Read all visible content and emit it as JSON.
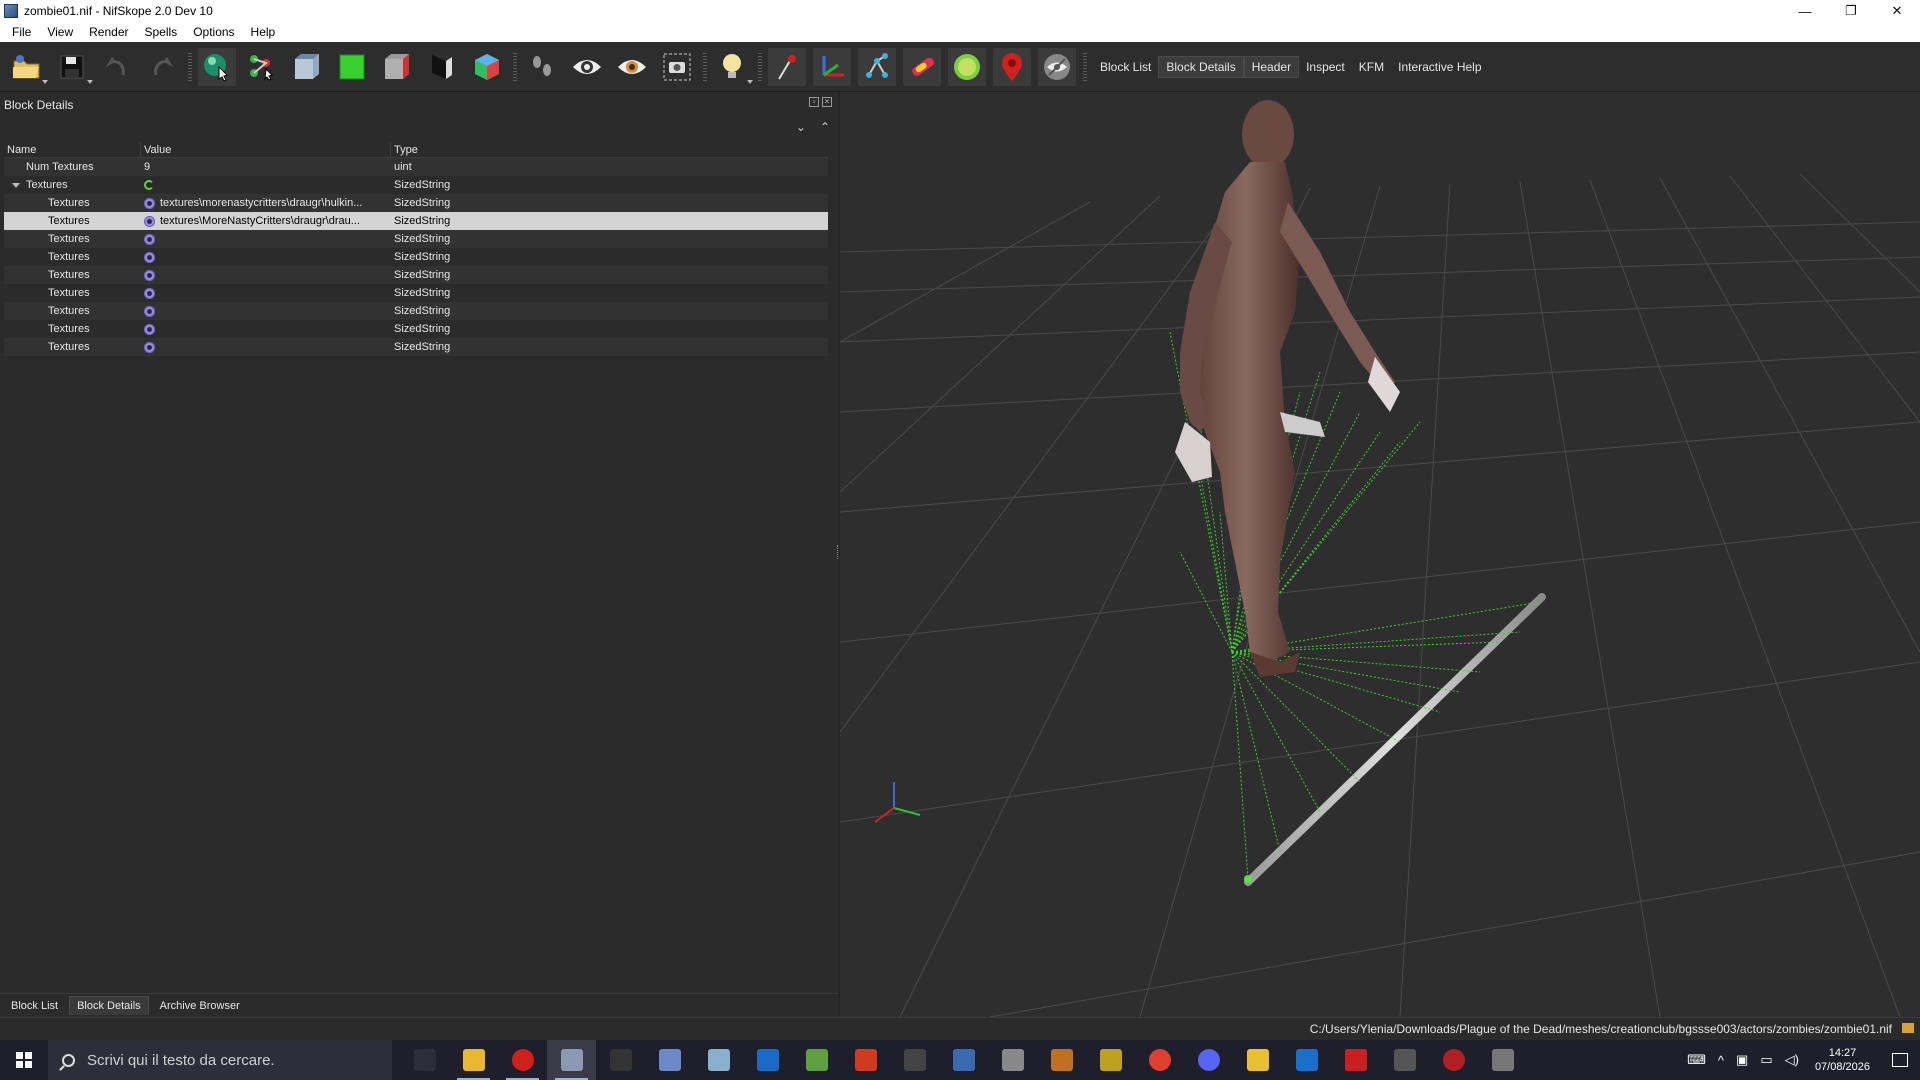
{
  "window": {
    "title": "zombie01.nif - NifSkope 2.0 Dev 10",
    "minimize": "—",
    "restore": "❐",
    "close": "✕"
  },
  "menu": [
    "File",
    "View",
    "Render",
    "Spells",
    "Options",
    "Help"
  ],
  "toolbar": {
    "icons": [
      "open-icon",
      "save-icon",
      "undo-icon",
      "redo-icon",
      "select-icon",
      "bone-select-icon",
      "view-front-icon",
      "view-side-icon",
      "view-top-icon",
      "view-back-icon",
      "view-user-icon",
      "walk-icon",
      "show-icon",
      "hide-icon",
      "screenshot-icon",
      "light-icon",
      "show-nodes-icon",
      "show-axes-icon",
      "show-constraints-icon",
      "show-collision-icon",
      "show-markers-icon",
      "show-havok-icon",
      "show-hidden-icon"
    ],
    "tabs": [
      "Block List",
      "Block Details",
      "Header",
      "Inspect",
      "KFM",
      "Interactive Help"
    ],
    "active_tab": "Block Details"
  },
  "block_details": {
    "title": "Block Details",
    "columns": [
      "Name",
      "Value",
      "Type"
    ],
    "rows": [
      {
        "name": "Num Textures",
        "value": "9",
        "type": "uint",
        "level": 1,
        "icon": ""
      },
      {
        "name": "Textures",
        "value": "",
        "type": "SizedString",
        "level": 0,
        "icon": "refresh"
      },
      {
        "name": "Textures",
        "value": "textures\\morenastycritters\\draugr\\hulkin...",
        "type": "SizedString",
        "level": 2,
        "icon": "gear"
      },
      {
        "name": "Textures",
        "value": "textures\\MoreNastyCritters\\draugr\\drau...",
        "type": "SizedString",
        "level": 2,
        "icon": "gear"
      },
      {
        "name": "Textures",
        "value": "",
        "type": "SizedString",
        "level": 2,
        "icon": "gear"
      },
      {
        "name": "Textures",
        "value": "",
        "type": "SizedString",
        "level": 2,
        "icon": "gear"
      },
      {
        "name": "Textures",
        "value": "",
        "type": "SizedString",
        "level": 2,
        "icon": "gear"
      },
      {
        "name": "Textures",
        "value": "",
        "type": "SizedString",
        "level": 2,
        "icon": "gear"
      },
      {
        "name": "Textures",
        "value": "",
        "type": "SizedString",
        "level": 2,
        "icon": "gear"
      },
      {
        "name": "Textures",
        "value": "",
        "type": "SizedString",
        "level": 2,
        "icon": "gear"
      },
      {
        "name": "Textures",
        "value": "",
        "type": "SizedString",
        "level": 2,
        "icon": "gear"
      }
    ],
    "selected_row": 3
  },
  "dock_tabs": [
    "Block List",
    "Block Details",
    "Archive Browser"
  ],
  "active_dock_tab": "Block Details",
  "status": {
    "path": "C:/Users/Ylenia/Downloads/Plague of the Dead/meshes/creationclub/bgssse003/actors/zombies/zombie01.nif"
  },
  "taskbar": {
    "search_placeholder": "Scrivi qui il testo da cercare.",
    "apps": [
      "task-view-icon",
      "file-explorer-icon",
      "opera-icon",
      "nifskope-icon",
      "terminal-icon",
      "editor-icon",
      "game-icon",
      "store-icon",
      "notepad-icon",
      "app-f-icon",
      "app-chevron-icon",
      "app-window-icon",
      "app-folder-icon",
      "app-bird-icon",
      "app-map-icon",
      "chrome-icon",
      "discord-icon",
      "app-sticky-icon",
      "app-blue-icon",
      "app-red-icon",
      "app-castle-icon",
      "app-round-icon",
      "app-gear-icon"
    ],
    "time": "14:27",
    "date": "07/08/2026"
  },
  "colors": {
    "panel_bg": "#2b2b2b",
    "viewport_bg": "#2e2e2e",
    "selection": "#d4d4d4",
    "bone_lines": "#3fcf2f",
    "taskbar": "#1f1f2b"
  }
}
